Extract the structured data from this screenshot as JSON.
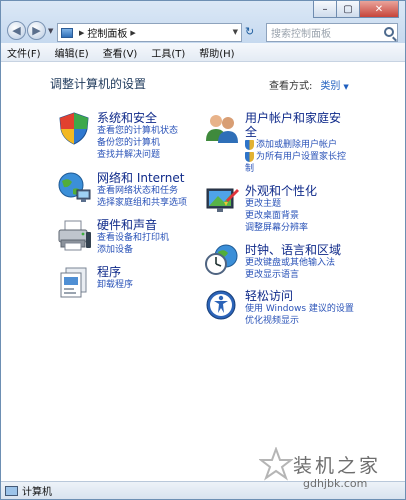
{
  "window": {
    "caption_buttons": {
      "minimize": "–",
      "maximize": "▢",
      "close": "✕"
    },
    "colors": {
      "link": "#2a53b8",
      "title": "#0f2a8a",
      "heading": "#1e395b"
    }
  },
  "nav": {
    "back_glyph": "◀",
    "forward_glyph": "▶",
    "recent_glyph": "▼"
  },
  "address": {
    "separator": "▶",
    "location": "控制面板",
    "trailing_separator": "▶",
    "dropdown_glyph": "▼"
  },
  "refresh": {
    "glyph": "↻"
  },
  "search": {
    "placeholder": "搜索控制面板"
  },
  "menu": [
    "文件(F)",
    "编辑(E)",
    "查看(V)",
    "工具(T)",
    "帮助(H)"
  ],
  "main": {
    "heading": "调整计算机的设置",
    "view_by_label": "查看方式:",
    "view_by_value": "类别",
    "view_by_arrow": "▼"
  },
  "categories": [
    {
      "id": "system-security",
      "title": "系统和安全",
      "icon": "shield-icon",
      "links": [
        "查看您的计算机状态",
        "备份您的计算机",
        "查找并解决问题"
      ]
    },
    {
      "id": "network-internet",
      "title": "网络和 Internet",
      "icon": "globe-network-icon",
      "links": [
        "查看网络状态和任务",
        "选择家庭组和共享选项"
      ]
    },
    {
      "id": "hardware-sound",
      "title": "硬件和声音",
      "icon": "printer-icon",
      "links": [
        "查看设备和打印机",
        "添加设备"
      ]
    },
    {
      "id": "programs",
      "title": "程序",
      "icon": "programs-icon",
      "links": [
        "卸载程序"
      ]
    },
    {
      "id": "user-accounts",
      "title_line1": "用户帐户和家庭安",
      "title_line2": "全",
      "icon": "users-icon",
      "links": [
        "添加或删除用户帐户",
        "为所有用户设置家长控",
        "制"
      ]
    },
    {
      "id": "appearance",
      "title": "外观和个性化",
      "icon": "paint-monitor-icon",
      "links": [
        "更改主题",
        "更改桌面背景",
        "调整屏幕分辨率"
      ]
    },
    {
      "id": "clock-region",
      "title": "时钟、语言和区域",
      "icon": "clock-globe-icon",
      "links": [
        "更改键盘或其他输入法",
        "更改显示语言"
      ]
    },
    {
      "id": "ease-access",
      "title": "轻松访问",
      "icon": "ease-of-access-icon",
      "links": [
        "使用 Windows 建议的设置",
        "优化视频显示"
      ]
    }
  ],
  "status": {
    "text": "计算机"
  },
  "watermark": {
    "title": "装机之家",
    "url": "gdhjbk.com"
  }
}
